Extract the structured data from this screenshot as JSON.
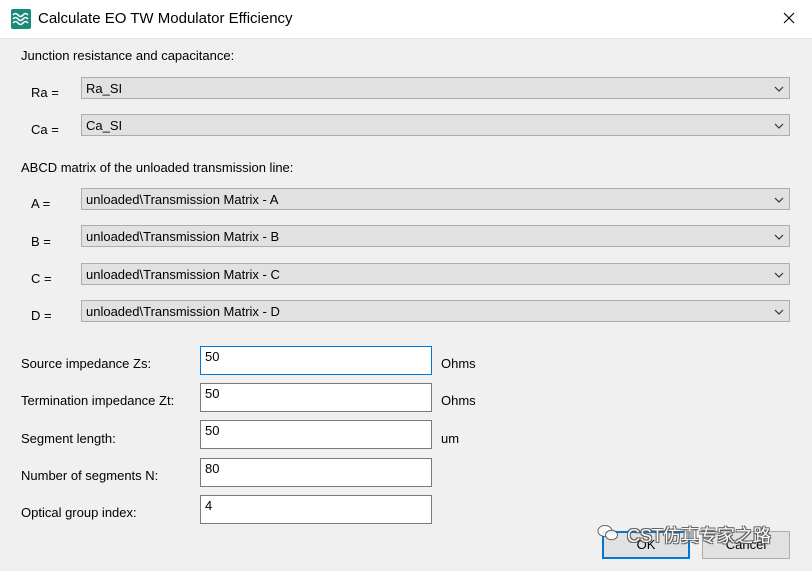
{
  "window": {
    "title": "Calculate EO TW Modulator Efficiency"
  },
  "junction": {
    "heading": "Junction resistance and capacitance:",
    "ra": {
      "label": "Ra =",
      "value": "Ra_SI"
    },
    "ca": {
      "label": "Ca =",
      "value": "Ca_SI"
    }
  },
  "abcd": {
    "heading": "ABCD matrix of the unloaded transmission line:",
    "a": {
      "label": "A =",
      "value": "unloaded\\Transmission Matrix - A"
    },
    "b": {
      "label": "B =",
      "value": "unloaded\\Transmission Matrix - B"
    },
    "c": {
      "label": "C =",
      "value": "unloaded\\Transmission Matrix - C"
    },
    "d": {
      "label": "D =",
      "value": "unloaded\\Transmission Matrix - D"
    }
  },
  "fields": {
    "source": {
      "label": "Source impedance Zs:",
      "value": "50",
      "unit": "Ohms"
    },
    "termination": {
      "label": "Termination impedance Zt:",
      "value": "50",
      "unit": "Ohms"
    },
    "segment_length": {
      "label": "Segment length:",
      "value": "50",
      "unit": "um"
    },
    "num_segments": {
      "label": "Number of segments N:",
      "value": "80"
    },
    "group_index": {
      "label": "Optical group index:",
      "value": "4"
    }
  },
  "buttons": {
    "ok": "OK",
    "cancel": "Cancel"
  },
  "watermark": {
    "text": "CST仿真专家之路"
  },
  "icons": {
    "app": "app-waves-icon",
    "close": "close-icon",
    "dropdown": "chevron-down-icon",
    "watermark": "wechat-icon"
  },
  "colors": {
    "accent": "#0078d7",
    "app_icon": "#1a8a7a",
    "dialog_bg": "#f0f0f0",
    "combo_bg": "#e1e1e1"
  }
}
